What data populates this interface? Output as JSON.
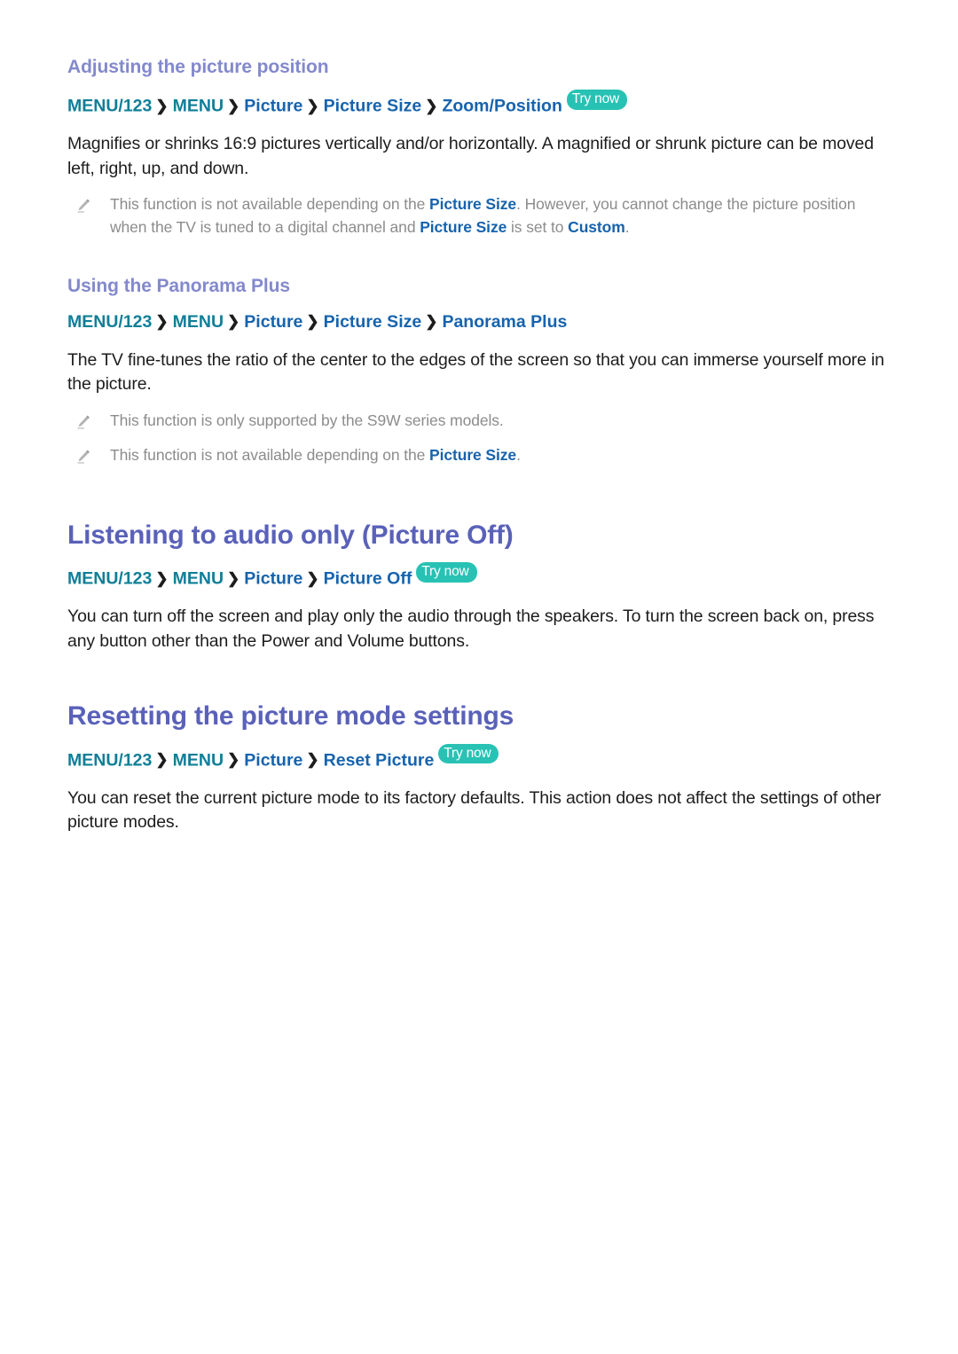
{
  "colors": {
    "h1": "#5a61b9",
    "h3": "#8389cc",
    "crumb_teal": "#0f7f97",
    "crumb_blue": "#1763ad",
    "try_now_badge": "#28c2b4",
    "body_text": "#1d1d1d",
    "note_text": "#8c8c8c",
    "page_background": "#ffffff"
  },
  "icons": {
    "note": "pencil-icon",
    "chevron": "chevron-right-icon"
  },
  "labels": {
    "try_now": "Try now",
    "chevron": "❯"
  },
  "sections": [
    {
      "id": "adjusting-the-picture-position",
      "heading_level": "h3",
      "heading": "Adjusting the picture position",
      "breadcrumb": {
        "segments": [
          {
            "text": "MENU/123",
            "color": "teal"
          },
          {
            "text": "MENU",
            "color": "teal"
          },
          {
            "text": "Picture",
            "color": "blue"
          },
          {
            "text": "Picture Size",
            "color": "blue"
          },
          {
            "text": "Zoom/Position",
            "color": "blue"
          }
        ],
        "try_now": true
      },
      "paragraph": "Magnifies or shrinks 16:9 pictures vertically and/or horizontally. A magnified or shrunk picture can be moved left, right, up, and down.",
      "notes": [
        {
          "parts": [
            {
              "text": "This function is not available depending on the ",
              "emphasis": false
            },
            {
              "text": "Picture Size",
              "emphasis": true
            },
            {
              "text": ". However, you cannot change the picture position when the TV is tuned to a digital channel and ",
              "emphasis": false
            },
            {
              "text": "Picture Size",
              "emphasis": true
            },
            {
              "text": " is set to ",
              "emphasis": false
            },
            {
              "text": "Custom",
              "emphasis": true
            },
            {
              "text": ".",
              "emphasis": false
            }
          ]
        }
      ]
    },
    {
      "id": "using-the-panorama-plus",
      "heading_level": "h3",
      "heading": "Using the Panorama Plus",
      "breadcrumb": {
        "segments": [
          {
            "text": "MENU/123",
            "color": "teal"
          },
          {
            "text": "MENU",
            "color": "teal"
          },
          {
            "text": "Picture",
            "color": "blue"
          },
          {
            "text": "Picture Size",
            "color": "blue"
          },
          {
            "text": "Panorama Plus",
            "color": "blue"
          }
        ],
        "try_now": false
      },
      "paragraph": "The TV fine-tunes the ratio of the center to the edges of the screen so that you can immerse yourself more in the picture.",
      "notes": [
        {
          "parts": [
            {
              "text": "This function is only supported by the S9W series models.",
              "emphasis": false
            }
          ]
        },
        {
          "parts": [
            {
              "text": "This function is not available depending on the ",
              "emphasis": false
            },
            {
              "text": "Picture Size",
              "emphasis": true
            },
            {
              "text": ".",
              "emphasis": false
            }
          ]
        }
      ]
    },
    {
      "id": "listening-to-audio-only",
      "heading_level": "h1",
      "heading": "Listening to audio only (Picture Off)",
      "breadcrumb": {
        "segments": [
          {
            "text": "MENU/123",
            "color": "teal"
          },
          {
            "text": "MENU",
            "color": "teal"
          },
          {
            "text": "Picture",
            "color": "blue"
          },
          {
            "text": "Picture Off",
            "color": "blue"
          }
        ],
        "try_now": true
      },
      "paragraph": "You can turn off the screen and play only the audio through the speakers. To turn the screen back on, press any button other than the Power and Volume buttons.",
      "notes": []
    },
    {
      "id": "resetting-the-picture-mode-settings",
      "heading_level": "h1",
      "heading": "Resetting the picture mode settings",
      "breadcrumb": {
        "segments": [
          {
            "text": "MENU/123",
            "color": "teal"
          },
          {
            "text": "MENU",
            "color": "teal"
          },
          {
            "text": "Picture",
            "color": "blue"
          },
          {
            "text": "Reset Picture",
            "color": "blue"
          }
        ],
        "try_now": true
      },
      "paragraph": "You can reset the current picture mode to its factory defaults. This action does not affect the settings of other picture modes.",
      "notes": []
    }
  ]
}
